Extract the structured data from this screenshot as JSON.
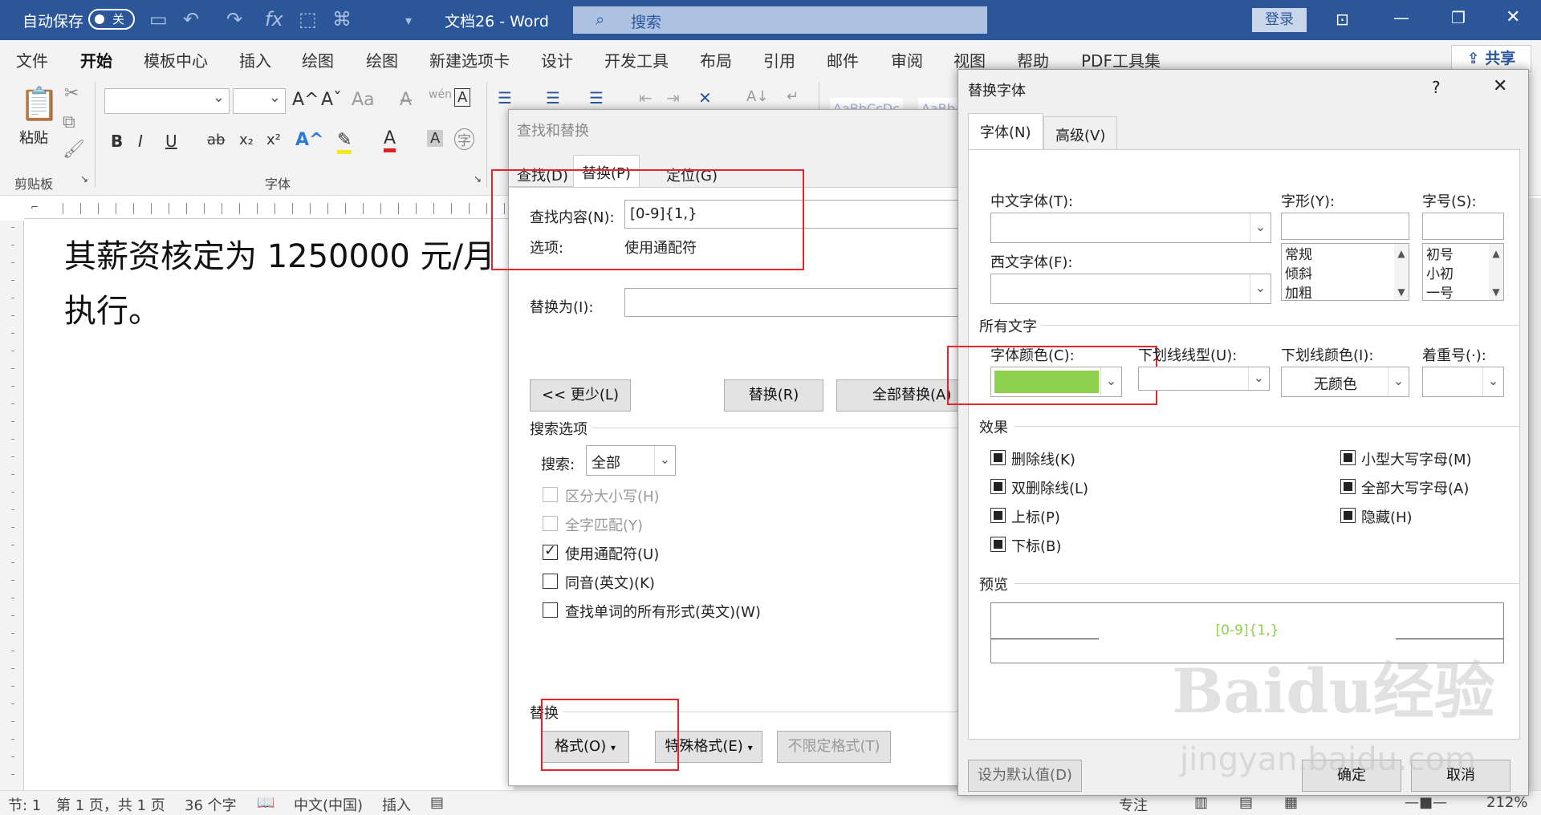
{
  "titlebar": {
    "autosave_label": "自动保存",
    "autosave_state": "关",
    "doc_title": "文档26  -  Word",
    "search_placeholder": "搜索",
    "login_label": "登录"
  },
  "menu": {
    "items": [
      "文件",
      "开始",
      "模板中心",
      "插入",
      "绘图",
      "绘图",
      "新建选项卡",
      "设计",
      "开发工具",
      "布局",
      "引用",
      "邮件",
      "审阅",
      "视图",
      "帮助",
      "PDF工具集"
    ],
    "active": "开始",
    "share_label": "共享"
  },
  "ribbon": {
    "paste_label": "粘贴",
    "clipboard_group": "剪贴板",
    "font_group": "字体",
    "style_preview_1": "AaBbCcDc",
    "style_preview_2": "AaBb",
    "buttons": {
      "bold": "B",
      "italic": "I",
      "underline": "U",
      "strike": "ab",
      "subscript": "x₂",
      "superscript": "x²",
      "grow": "A^",
      "shrink": "Aˇ",
      "case": "Aa",
      "phonetic": "wén",
      "border_char": "A",
      "font_color": "A",
      "highlight": "A",
      "char_shade": "A",
      "enclose": "字"
    }
  },
  "document": {
    "line1": "其薪资核定为 1250000 元/月",
    "line2": "执行。"
  },
  "statusbar": {
    "section": "节: 1",
    "page": "第 1 页，共 1 页",
    "words": "36 个字",
    "lang": "中文(中国)",
    "mode": "插入",
    "focus": "专注",
    "zoom": "212%"
  },
  "find_dialog": {
    "title": "查找和替换",
    "tabs": [
      "查找(D)",
      "替换(P)",
      "定位(G)"
    ],
    "active_tab": "替换(P)",
    "find_label": "查找内容(N):",
    "find_value": "[0-9]{1,}",
    "options_label": "选项:",
    "options_value": "使用通配符",
    "replace_label": "替换为(I):",
    "replace_value": "",
    "less_button": "<< 更少(L)",
    "replace_button": "替换(R)",
    "replace_all_button": "全部替换(A)",
    "search_options_group": "搜索选项",
    "search_label": "搜索:",
    "search_value": "全部",
    "checkboxes": [
      {
        "label": "区分大小写(H)",
        "checked": false,
        "disabled": true
      },
      {
        "label": "全字匹配(Y)",
        "checked": false,
        "disabled": true
      },
      {
        "label": "使用通配符(U)",
        "checked": true,
        "disabled": false
      },
      {
        "label": "同音(英文)(K)",
        "checked": false,
        "disabled": false
      },
      {
        "label": "查找单词的所有形式(英文)(W)",
        "checked": false,
        "disabled": false
      }
    ],
    "replace_group": "替换",
    "format_button": "格式(O)",
    "special_button": "特殊格式(E)",
    "no_format_button": "不限定格式(T)"
  },
  "font_dialog": {
    "title": "替换字体",
    "help": "?",
    "close": "✕",
    "tabs": [
      "字体(N)",
      "高级(V)"
    ],
    "active_tab": "字体(N)",
    "cn_font_label": "中文字体(T):",
    "cn_font_value": "",
    "west_font_label": "西文字体(F):",
    "west_font_value": "",
    "style_label": "字形(Y):",
    "style_items": [
      "常规",
      "倾斜",
      "加粗"
    ],
    "size_label": "字号(S):",
    "size_items": [
      "初号",
      "小初",
      "一号"
    ],
    "all_text_group": "所有文字",
    "font_color_label": "字体颜色(C):",
    "font_color_value": "#8ed14c",
    "underline_style_label": "下划线线型(U):",
    "underline_color_label": "下划线颜色(I):",
    "underline_color_value": "无颜色",
    "emphasis_label": "着重号(·):",
    "effects_group": "效果",
    "effects_left": [
      "删除线(K)",
      "双删除线(L)",
      "上标(P)",
      "下标(B)"
    ],
    "effects_right": [
      "小型大写字母(M)",
      "全部大写字母(A)",
      "隐藏(H)"
    ],
    "preview_group": "预览",
    "preview_text": "[0-9]{1,}",
    "default_button": "设为默认值(D)",
    "ok_button": "确定",
    "cancel_button": "取消"
  },
  "watermark": {
    "text": "Baidu经验",
    "url": "jingyan.baidu.com"
  }
}
